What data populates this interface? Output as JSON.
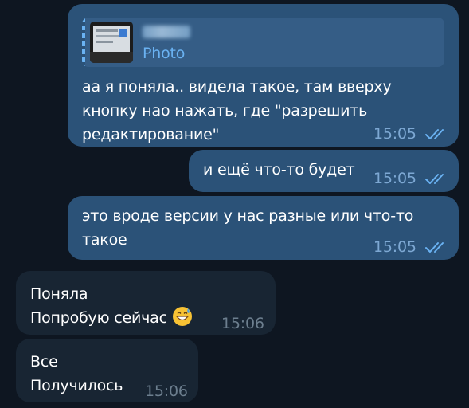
{
  "messages": [
    {
      "direction": "outgoing",
      "reply": {
        "sender": "",
        "label": "Photo"
      },
      "text": "аа я поняла.. видела такое, там вверху\nкнопку нао нажать, где \"разрешить\nредактирование\"",
      "time": "15:05",
      "status": "read"
    },
    {
      "direction": "outgoing",
      "text": "и ещё что-то будет",
      "time": "15:05",
      "status": "read"
    },
    {
      "direction": "outgoing",
      "text": "это вроде версии у нас разные или что-то\nтакое",
      "time": "15:05",
      "status": "read"
    },
    {
      "direction": "incoming",
      "text": "Поняла\nПопробую сейчас",
      "emoji": "grinning-face-with-sweat",
      "time": "15:06"
    },
    {
      "direction": "incoming",
      "text": "Все\nПолучилось",
      "time": "15:06"
    }
  ],
  "colors": {
    "background": "#0e1621",
    "outgoing_bubble": "#2b5278",
    "incoming_bubble": "#182533",
    "outgoing_time": "#7da8d3",
    "incoming_time": "#6d7f8f",
    "read_ticks": "#6ab2f2",
    "reply_accent": "#6ab2f2"
  },
  "icons": {
    "read_status": "double-check-icon",
    "reply_thumbnail": "photo-thumbnail"
  }
}
